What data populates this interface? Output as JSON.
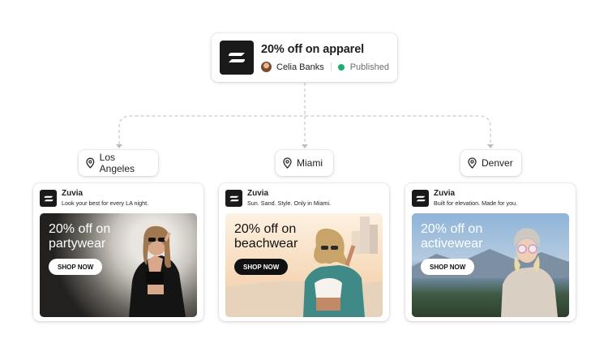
{
  "campaign": {
    "title": "20% off on apparel",
    "owner": "Celia Banks",
    "status": "Published",
    "status_color": "#1ab06c",
    "logo_icon": "brand-mark-icon"
  },
  "locations": [
    {
      "name": "Los Angeles",
      "icon": "map-pin-icon"
    },
    {
      "name": "Miami",
      "icon": "map-pin-icon"
    },
    {
      "name": "Denver",
      "icon": "map-pin-icon"
    }
  ],
  "ads": [
    {
      "brand": "Zuvia",
      "tagline": "Look your best for every LA night.",
      "headline": "20% off on\npartywear",
      "cta": "SHOP NOW"
    },
    {
      "brand": "Zuvia",
      "tagline": "Sun. Sand. Style. Only in Miami.",
      "headline": "20% off on\nbeachwear",
      "cta": "SHOP NOW"
    },
    {
      "brand": "Zuvia",
      "tagline": "Built for elevation. Made for you.",
      "headline": "20% off on\nactivewear",
      "cta": "SHOP NOW"
    }
  ]
}
